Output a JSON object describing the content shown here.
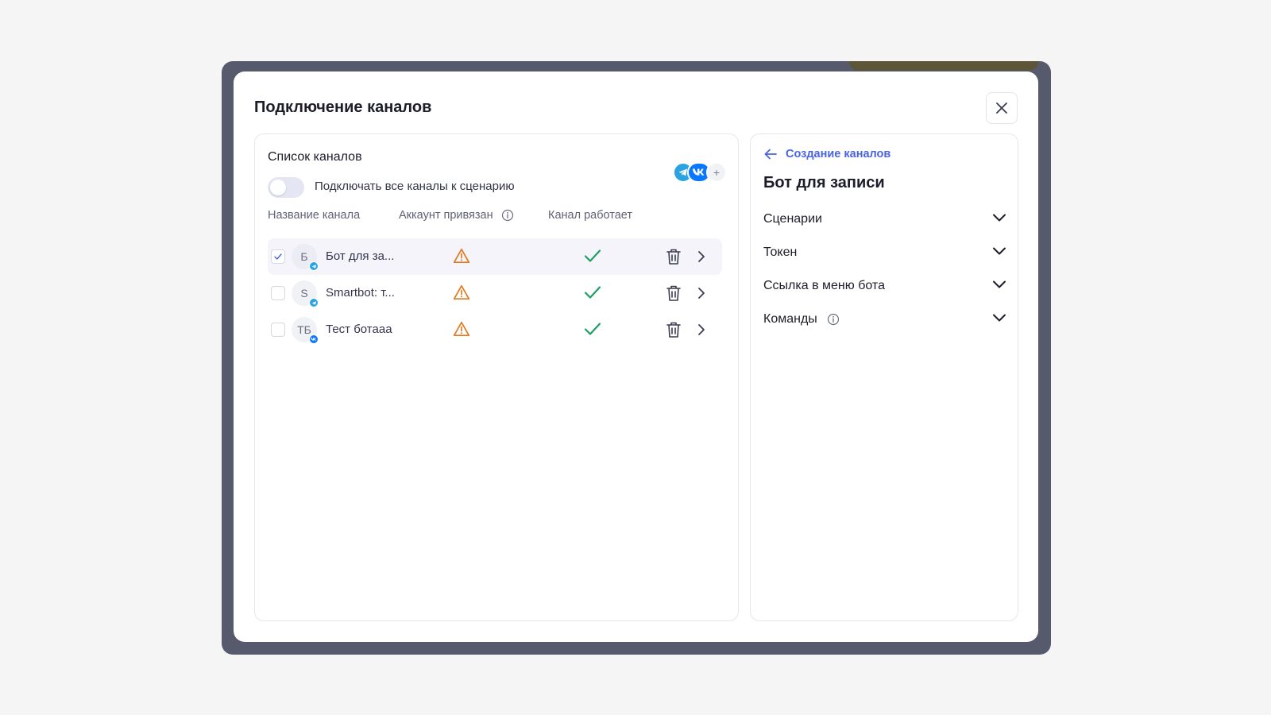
{
  "modal": {
    "title": "Подключение каналов"
  },
  "channel_list": {
    "title": "Список каналов",
    "toggle_label": "Подключать все каналы к сценарию",
    "toggle_on": false,
    "add_channel_plus": "+",
    "columns": {
      "name": "Название канала",
      "account_linked": "Аккаунт привязан",
      "channel_works": "Канал работает"
    },
    "rows": [
      {
        "avatar": "Б",
        "name": "Бот для за...",
        "network": "telegram",
        "checked": true,
        "selected": true
      },
      {
        "avatar": "S",
        "name": "Smartbot: т...",
        "network": "telegram",
        "checked": false,
        "selected": false
      },
      {
        "avatar": "ТБ",
        "name": "Тест ботааа",
        "network": "vk",
        "checked": false,
        "selected": false
      }
    ]
  },
  "details": {
    "back_label": "Создание каналов",
    "bot_title": "Бот для записи",
    "sections": [
      {
        "label": "Сценарии",
        "info": false
      },
      {
        "label": "Токен",
        "info": false
      },
      {
        "label": "Ссылка в меню бота",
        "info": false
      },
      {
        "label": "Команды",
        "info": true
      }
    ]
  },
  "colors": {
    "accent": "#4a63e0",
    "warning": "#e07a1f",
    "success": "#1f9d63",
    "telegram": "#2aa3e0",
    "vk": "#0a77ff",
    "backdrop": "#575a6c"
  },
  "icons": {
    "close": "close-icon",
    "info": "info-icon",
    "warning": "warning-icon",
    "check": "check-icon",
    "trash": "trash-icon",
    "chevron_right": "chevron-right-icon",
    "chevron_down": "chevron-down-icon",
    "back": "arrow-left-icon"
  }
}
